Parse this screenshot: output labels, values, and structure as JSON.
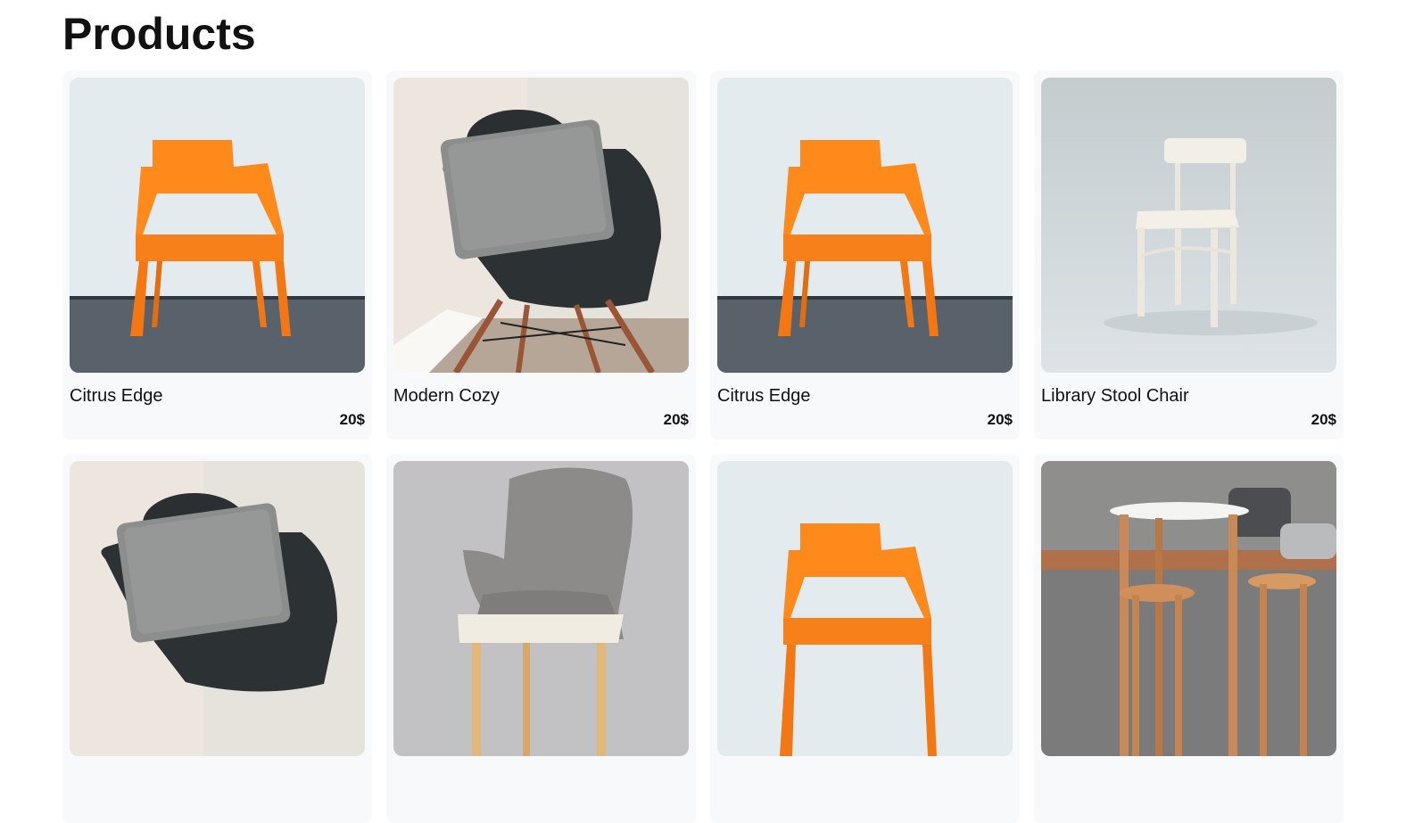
{
  "page": {
    "title": "Products"
  },
  "products": [
    {
      "name": "Citrus Edge",
      "price": "20$",
      "image": "orange-chair-image"
    },
    {
      "name": "Modern Cozy",
      "price": "20$",
      "image": "black-chair-pillow-image"
    },
    {
      "name": "Citrus Edge",
      "price": "20$",
      "image": "orange-chair-image"
    },
    {
      "name": "Library Stool Chair",
      "price": "20$",
      "image": "white-wooden-chair-image"
    },
    {
      "name": "",
      "price": "",
      "image": "black-chair-pillow-image"
    },
    {
      "name": "",
      "price": "",
      "image": "grey-upholstered-chair-image"
    },
    {
      "name": "",
      "price": "",
      "image": "orange-chair-image"
    },
    {
      "name": "",
      "price": "",
      "image": "wooden-table-stools-image"
    }
  ]
}
